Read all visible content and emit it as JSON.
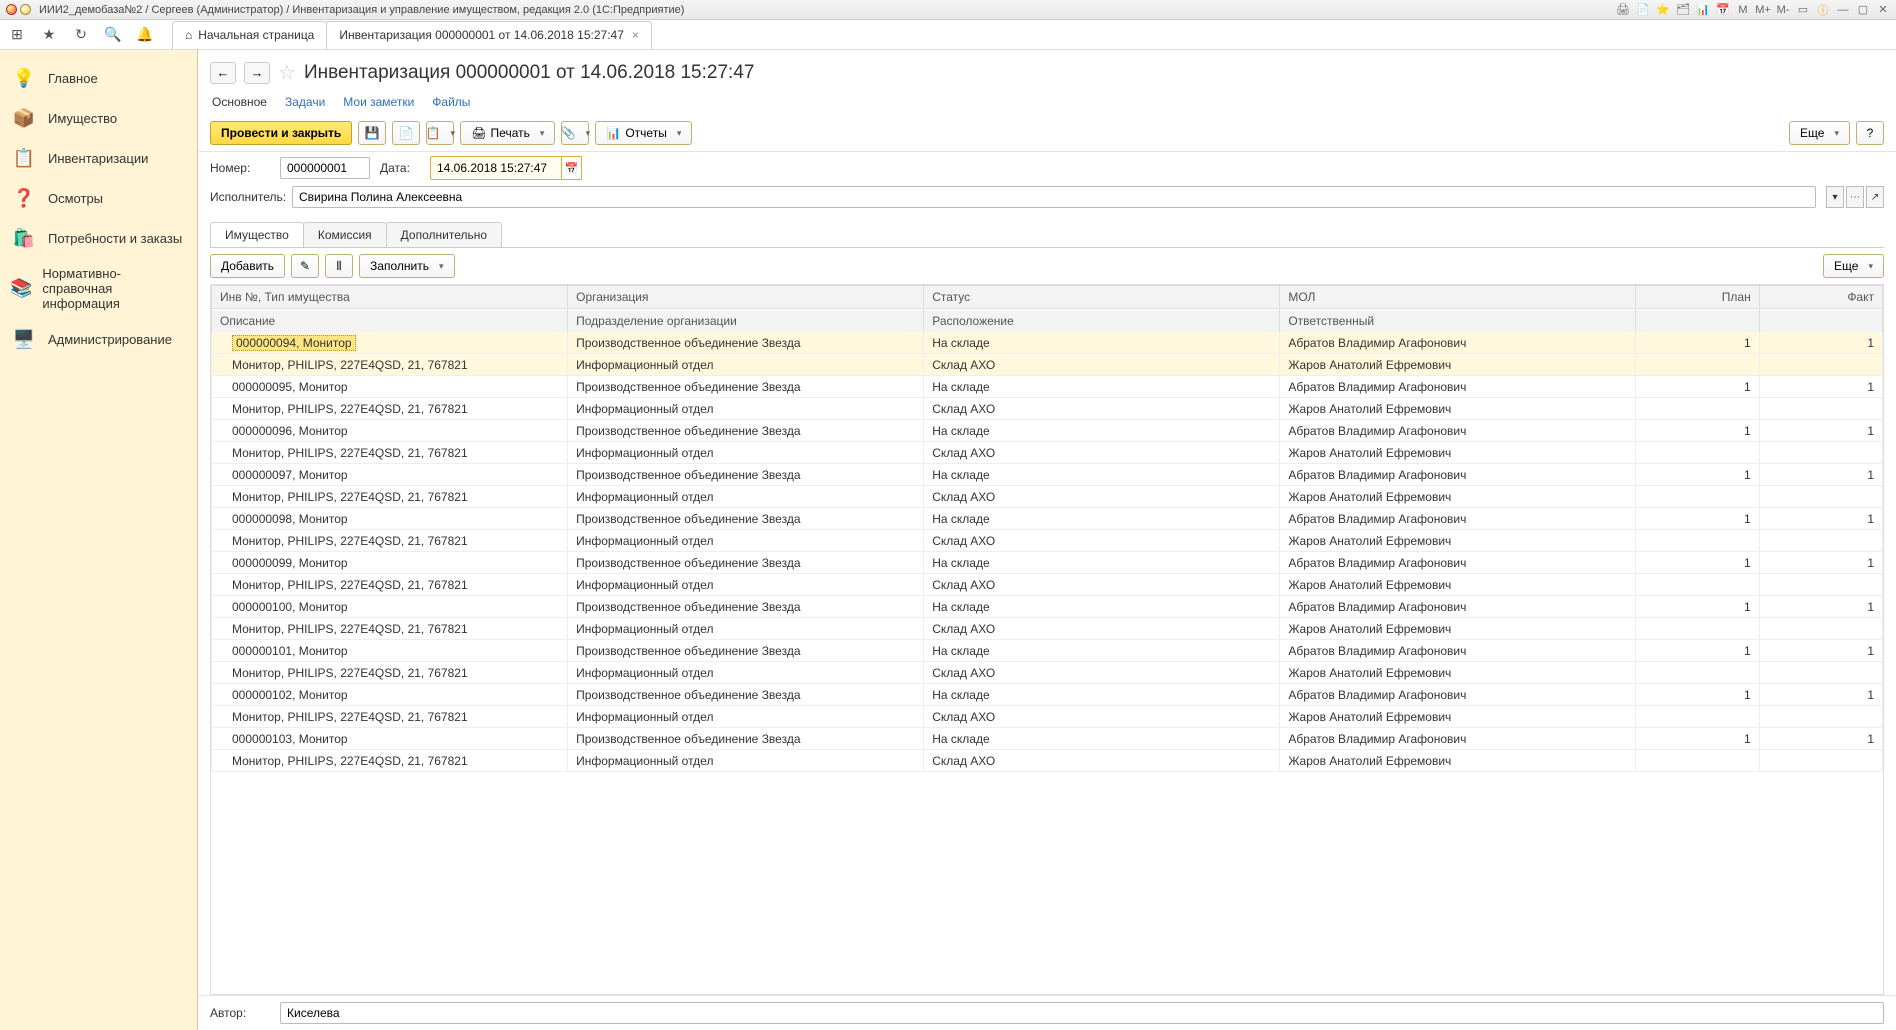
{
  "window": {
    "title": "ИИИ2_демобаза№2 / Сергеев (Администратор) / Инвентаризация и управление имуществом, редакция 2.0  (1С:Предприятие)"
  },
  "tabs": {
    "home": "Начальная страница",
    "doc": "Инвентаризация 000000001 от 14.06.2018 15:27:47"
  },
  "sidebar": {
    "items": [
      {
        "icon": "💡",
        "label": "Главное"
      },
      {
        "icon": "📦",
        "label": "Имущество"
      },
      {
        "icon": "📋",
        "label": "Инвентаризации"
      },
      {
        "icon": "❓",
        "label": "Осмотры"
      },
      {
        "icon": "🛍️",
        "label": "Потребности и заказы"
      },
      {
        "icon": "📚",
        "label": "Нормативно-справочная информация"
      },
      {
        "icon": "🖥️",
        "label": "Администрирование"
      }
    ]
  },
  "page": {
    "title": "Инвентаризация 000000001 от 14.06.2018 15:27:47"
  },
  "subnav": {
    "main": "Основное",
    "tasks": "Задачи",
    "notes": "Мои заметки",
    "files": "Файлы"
  },
  "cmdbar": {
    "post_close": "Провести и закрыть",
    "print": "Печать",
    "reports": "Отчеты",
    "more": "Еще"
  },
  "form": {
    "num_label": "Номер:",
    "num_value": "000000001",
    "date_label": "Дата:",
    "date_value": "14.06.2018 15:27:47",
    "isp_label": "Исполнитель:",
    "isp_value": "Свирина Полина Алексеевна"
  },
  "inner_tabs": {
    "property": "Имущество",
    "commission": "Комиссия",
    "extra": "Дополнительно"
  },
  "table_tools": {
    "add": "Добавить",
    "fill": "Заполнить",
    "more": "Еще"
  },
  "columns": {
    "inv": "Инв №, Тип имущества",
    "org": "Организация",
    "status": "Статус",
    "mol": "МОЛ",
    "plan": "План",
    "fact": "Факт",
    "desc": "Описание",
    "dept": "Подразделение организации",
    "loc": "Расположение",
    "resp": "Ответственный"
  },
  "common": {
    "org": "Производственное объединение Звезда",
    "dept": "Информационный отдел",
    "status": "На складе",
    "loc": "Склад АХО",
    "mol": "Абратов Владимир Агафонович",
    "resp": "Жаров Анатолий Ефремович",
    "desc": "Монитор, PHILIPS, 227E4QSD, 21, 767821"
  },
  "rows": [
    {
      "inv": "000000094, Монитор",
      "plan": "1",
      "fact": "1"
    },
    {
      "inv": "000000095, Монитор",
      "plan": "1",
      "fact": "1"
    },
    {
      "inv": "000000096, Монитор",
      "plan": "1",
      "fact": "1"
    },
    {
      "inv": "000000097, Монитор",
      "plan": "1",
      "fact": "1"
    },
    {
      "inv": "000000098, Монитор",
      "plan": "1",
      "fact": "1"
    },
    {
      "inv": "000000099, Монитор",
      "plan": "1",
      "fact": "1"
    },
    {
      "inv": "000000100, Монитор",
      "plan": "1",
      "fact": "1"
    },
    {
      "inv": "000000101, Монитор",
      "plan": "1",
      "fact": "1"
    },
    {
      "inv": "000000102, Монитор",
      "plan": "1",
      "fact": "1"
    },
    {
      "inv": "000000103, Монитор",
      "plan": "1",
      "fact": "1"
    }
  ],
  "footer": {
    "author_label": "Автор:",
    "author_value": "Киселева"
  }
}
